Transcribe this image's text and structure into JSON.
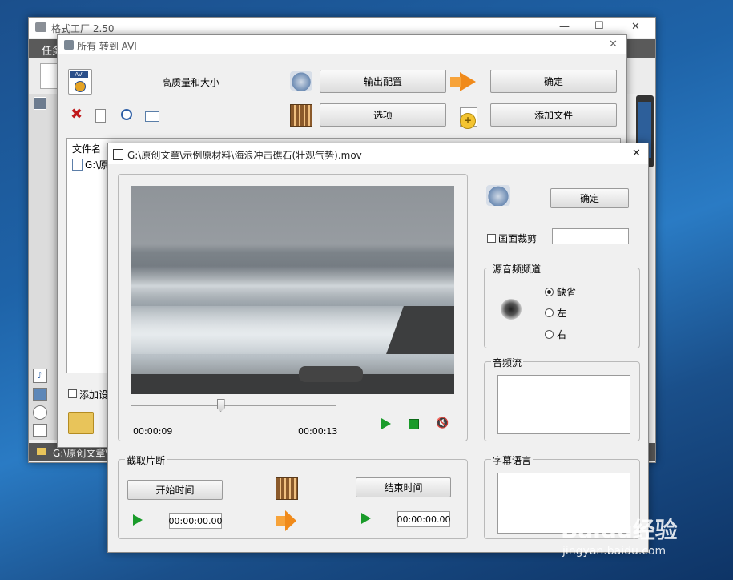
{
  "main_window": {
    "title": "格式工厂 2.50",
    "menu_fragment": "任务",
    "status_text": "G:\\原创文章\\",
    "controls": {
      "minimize": "—",
      "maximize": "☐",
      "close": "✕"
    }
  },
  "dialog_avi": {
    "title": "所有 转到 AVI",
    "quality_label": "高质量和大小",
    "output_config_button": "输出配置",
    "ok_button": "确定",
    "options_button": "选项",
    "add_file_button": "添加文件",
    "filename_header": "文件名",
    "file_entry": "G:\\原",
    "add_settings_label": "添加设",
    "close": "✕"
  },
  "dialog_clip": {
    "title": "G:\\原创文章\\示例原材料\\海浪冲击礁石(壮观气势).mov",
    "close": "✕",
    "time_current": "00:00:09",
    "time_total": "00:00:13",
    "slider_position": 0.44,
    "ok_button": "确定",
    "crop_label": "画面裁剪",
    "crop_value": "",
    "audio_channel": {
      "legend": "源音频频道",
      "options": [
        "缺省",
        "左",
        "右"
      ],
      "selected": "缺省"
    },
    "audio_stream_legend": "音频流",
    "subtitle_legend": "字幕语言",
    "segment": {
      "legend": "截取片断",
      "start_button": "开始时间",
      "end_button": "结束时间",
      "start_value": "00:00:00.00",
      "end_value": "00:00:00.00"
    }
  },
  "watermark": {
    "brand": "Baidu经验",
    "url": "jingyan.baidu.com"
  }
}
